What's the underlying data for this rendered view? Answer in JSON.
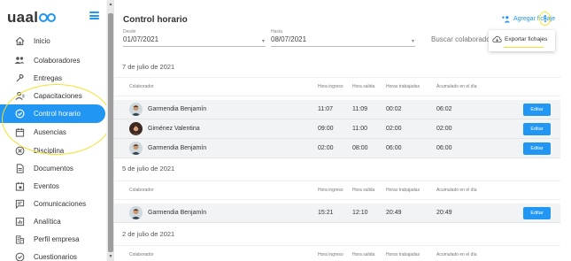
{
  "app": {
    "logo": "uaal",
    "title": "Control horario"
  },
  "sidebar": {
    "items": [
      {
        "label": "Inicio",
        "icon": "home-icon"
      },
      {
        "label": "Colaboradores",
        "icon": "people-icon"
      },
      {
        "label": "Entregas",
        "icon": "tools-icon"
      },
      {
        "label": "Capacitaciones",
        "icon": "person-card-icon"
      },
      {
        "label": "Control horario",
        "icon": "clock-check-icon",
        "active": true
      },
      {
        "label": "Ausencias",
        "icon": "calendar-icon"
      },
      {
        "label": "Disciplina",
        "icon": "cancel-circle-icon"
      },
      {
        "label": "Documentos",
        "icon": "document-icon"
      },
      {
        "label": "Eventos",
        "icon": "event-calendar-icon"
      },
      {
        "label": "Comunicaciones",
        "icon": "chat-icon"
      },
      {
        "label": "Analítica",
        "icon": "analytics-icon"
      },
      {
        "label": "Perfil empresa",
        "icon": "building-icon"
      },
      {
        "label": "Cuestionarios",
        "icon": "check-circle-icon"
      }
    ]
  },
  "toolbar": {
    "add_label": "Agregar fichaje"
  },
  "menu": {
    "export_label": "Exportar fichajes"
  },
  "filters": {
    "desde_label": "Desde",
    "desde_value": "01/07/2021",
    "hasta_label": "Hasta",
    "hasta_value": "08/07/2021",
    "search_placeholder": "Buscar colaborador por nombre"
  },
  "columns": {
    "colaborador": "Colaborador",
    "hora_ingreso": "Hora ingreso",
    "hora_salida": "Hora salida",
    "horas_trabajadas": "Horas trabajadas",
    "acumulado": "Acumulado en el día"
  },
  "edit_label": "Editar",
  "groups": [
    {
      "date": "7 de julio de 2021",
      "rows": [
        {
          "name": "Garmendia Benjamín",
          "in": "11:07",
          "out": "11:09",
          "worked": "00:02",
          "acc": "06:02"
        },
        {
          "name": "Giménez Valentina",
          "in": "09:00",
          "out": "11:00",
          "worked": "02:00",
          "acc": "02:00"
        },
        {
          "name": "Garmendia Benjamín",
          "in": "02:00",
          "out": "08:00",
          "worked": "06:00",
          "acc": "06:00"
        }
      ]
    },
    {
      "date": "5 de julio de 2021",
      "rows": [
        {
          "name": "Garmendia Benjamín",
          "in": "15:21",
          "out": "12:10",
          "worked": "20:49",
          "acc": "20:49"
        }
      ]
    },
    {
      "date": "2 de julio de 2021",
      "rows": []
    }
  ],
  "colors": {
    "accent": "#2196f3",
    "highlight": "#f3e12a",
    "row_bg": "#f1f3f5"
  }
}
